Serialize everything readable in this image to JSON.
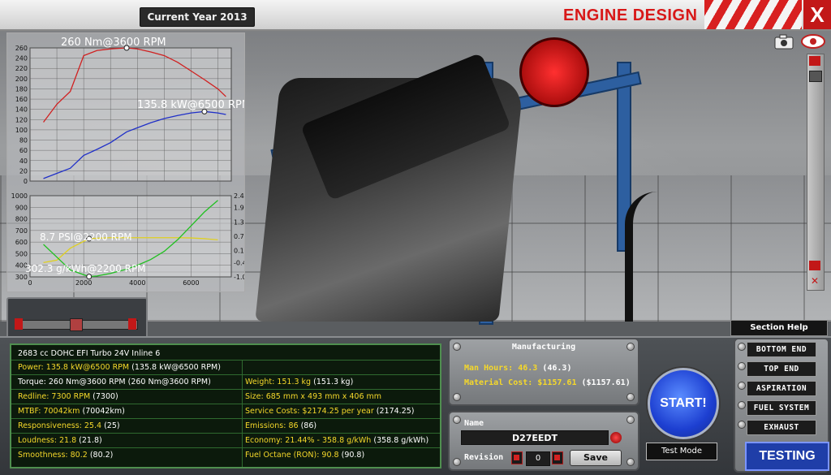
{
  "header": {
    "year_label": "Current Year 2013",
    "title": "ENGINE DESIGN",
    "close_label": "X"
  },
  "chart_data": [
    {
      "type": "line",
      "title": "",
      "x": [
        500,
        1000,
        1500,
        2000,
        2500,
        3000,
        3600,
        4000,
        4500,
        5000,
        5500,
        6000,
        6500,
        7000,
        7300
      ],
      "xlim": [
        0,
        7500
      ],
      "ylim": [
        0,
        260
      ],
      "yticks": [
        "0",
        "20",
        "40",
        "60",
        "80",
        "100",
        "120",
        "140",
        "160",
        "180",
        "200",
        "220",
        "240",
        "260"
      ],
      "series": [
        {
          "name": "Torque",
          "color": "#d02020",
          "values": [
            115,
            150,
            175,
            245,
            255,
            258,
            260,
            258,
            252,
            245,
            232,
            215,
            198,
            180,
            165
          ]
        },
        {
          "name": "Power",
          "color": "#2030c8",
          "values": [
            5,
            15,
            25,
            50,
            62,
            75,
            96,
            104,
            114,
            122,
            128,
            133,
            135.8,
            133,
            130
          ]
        }
      ],
      "annotations": [
        "260 Nm@3600 RPM",
        "135.8 kW@6500 RPM"
      ]
    },
    {
      "type": "line",
      "title": "",
      "x": [
        500,
        1000,
        1500,
        2200,
        2500,
        3000,
        3500,
        4000,
        4500,
        5000,
        5500,
        6000,
        6500,
        7000
      ],
      "xticks": [
        "0",
        "2000",
        "4000",
        "6000"
      ],
      "xlim": [
        0,
        7500
      ],
      "ylim_left": [
        300,
        1000
      ],
      "yticks_left": [
        "300",
        "400",
        "500",
        "600",
        "700",
        "800",
        "900",
        "1000"
      ],
      "ylim_right": [
        -1.0,
        2.4
      ],
      "yticks_right": [
        "-1.0",
        "-0.4",
        "0.1",
        "0.7",
        "1.3",
        "1.9",
        "2.4"
      ],
      "series": [
        {
          "name": "Boost",
          "color": "#e0d020",
          "axis": "right",
          "values": [
            -0.4,
            -0.3,
            0.2,
            0.6,
            0.62,
            0.64,
            0.64,
            0.64,
            0.64,
            0.64,
            0.64,
            0.63,
            0.6,
            0.55
          ]
        },
        {
          "name": "Economy",
          "color": "#20c020",
          "axis": "left",
          "values": [
            580,
            470,
            360,
            302.3,
            308,
            330,
            360,
            400,
            450,
            520,
            620,
            740,
            860,
            960
          ]
        }
      ],
      "annotations": [
        "8.7 PSI@2200 RPM",
        "302.3 g/kWh@2200 RPM"
      ]
    }
  ],
  "stats": {
    "engine": "2683 cc DOHC EFI Turbo 24V Inline 6",
    "power": "Power: 135.8 kW@6500 RPM",
    "power_ref": "(135.8 kW@6500 RPM)",
    "torque": "Torque: 260 Nm@3600 RPM",
    "torque_ref": "(260 Nm@3600 RPM)",
    "redline": "Redline: 7300 RPM",
    "redline_ref": "(7300)",
    "mtbf": "MTBF: 70042km",
    "mtbf_ref": "(70042km)",
    "responsiveness": "Responsiveness: 25.4",
    "responsiveness_ref": "(25)",
    "loudness": "Loudness: 21.8",
    "loudness_ref": "(21.8)",
    "smoothness": "Smoothness: 80.2",
    "smoothness_ref": "(80.2)",
    "weight": "Weight: 151.3 kg",
    "weight_ref": "(151.3 kg)",
    "size": "Size: 685 mm x 493 mm x 406 mm",
    "service": "Service Costs: $2174.25 per year",
    "service_ref": "(2174.25)",
    "emissions": "Emissions: 86",
    "emissions_ref": "(86)",
    "economy": "Economy: 21.44% - 358.8 g/kWh",
    "economy_ref": "(358.8 g/kWh)",
    "octane": "Fuel Octane (RON): 90.8",
    "octane_ref": "(90.8)"
  },
  "manufacturing": {
    "title": "Manufacturing",
    "man_hours": "Man Hours: 46.3",
    "man_hours_ref": "(46.3)",
    "material_cost": "Material Cost: $1157.61",
    "material_cost_ref": "($1157.61)"
  },
  "naming": {
    "name_label": "Name",
    "name_value": "D27EEDT",
    "revision_label": "Revision",
    "revision_value": "0",
    "save_label": "Save"
  },
  "controls": {
    "start_label": "START!",
    "test_mode_label": "Test Mode",
    "section_help_label": "Section Help",
    "sections": [
      "BOTTOM END",
      "TOP END",
      "ASPIRATION",
      "FUEL SYSTEM",
      "EXHAUST"
    ],
    "testing_label": "TESTING"
  },
  "colors": {
    "title_red": "#d81818",
    "highlight_yellow": "#f5d82a",
    "start_blue": "#1d3fd1",
    "testing_blue": "#1f3ea8"
  }
}
